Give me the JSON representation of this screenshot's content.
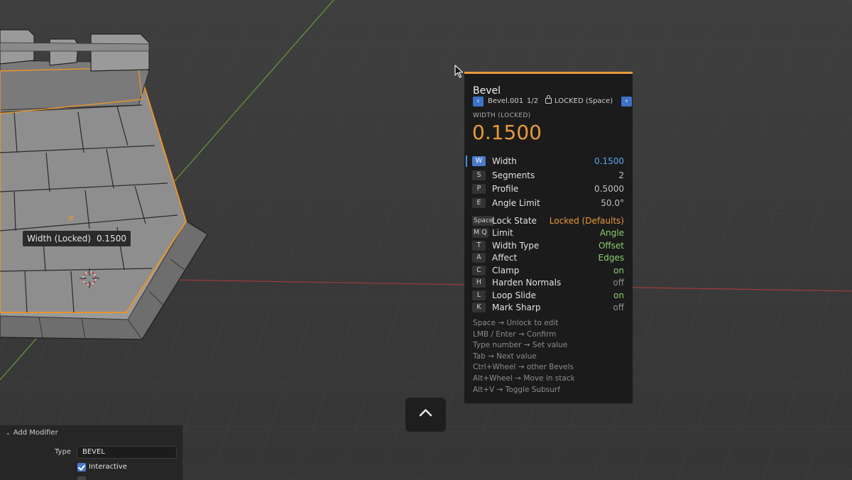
{
  "viewport": {
    "overlay_label": {
      "name": "Width (Locked)",
      "value": "0.1500"
    }
  },
  "operator_panel": {
    "title": "Bevel",
    "nav": {
      "prev_icon": "chevron-left-icon",
      "modifier_name": "Bevel.001",
      "position": "1/2",
      "lock_icon": "lock-icon",
      "lock_text": "LOCKED (Space)",
      "next_icon": "chevron-right-icon"
    },
    "current_param_label": "WIDTH (LOCKED)",
    "current_param_value": "0.1500",
    "params": [
      {
        "key": "W",
        "label": "Width",
        "value": "0.1500",
        "active": true
      },
      {
        "key": "S",
        "label": "Segments",
        "value": "2"
      },
      {
        "key": "P",
        "label": "Profile",
        "value": "0.5000"
      },
      {
        "key": "E",
        "label": "Angle Limit",
        "value": "50.0°"
      }
    ],
    "options": [
      {
        "key": "Space",
        "label": "Lock State",
        "value": "Locked (Defaults)",
        "tone": "orange"
      },
      {
        "key": "M Q",
        "label": "Limit",
        "value": "Angle",
        "tone": "green"
      },
      {
        "key": "T",
        "label": "Width Type",
        "value": "Offset",
        "tone": "green"
      },
      {
        "key": "A",
        "label": "Affect",
        "value": "Edges",
        "tone": "green"
      },
      {
        "key": "C",
        "label": "Clamp",
        "value": "on",
        "tone": "green"
      },
      {
        "key": "H",
        "label": "Harden Normals",
        "value": "off",
        "tone": "dim"
      },
      {
        "key": "L",
        "label": "Loop Slide",
        "value": "on",
        "tone": "green"
      },
      {
        "key": "K",
        "label": "Mark Sharp",
        "value": "off",
        "tone": "dim"
      }
    ],
    "help": [
      "Space → Unlock to edit",
      "LMB / Enter → Confirm",
      "Type number → Set value",
      "Tab → Next value",
      "Ctrl+Wheel → other Bevels",
      "Alt+Wheel → Move in stack",
      "Alt+V → Toggle Subsurf"
    ]
  },
  "toggle_button": {
    "icon": "chevron-up-icon"
  },
  "modifier_panel": {
    "header_icon": "chevron-down-icon",
    "title": "Add Modifier",
    "type_label": "Type",
    "type_value": "BEVEL",
    "interactive_label": "Interactive",
    "interactive_checked": true
  },
  "colors": {
    "accent": "#e89a3c",
    "blue": "#4a7bcc",
    "green": "#8bcf6c"
  }
}
